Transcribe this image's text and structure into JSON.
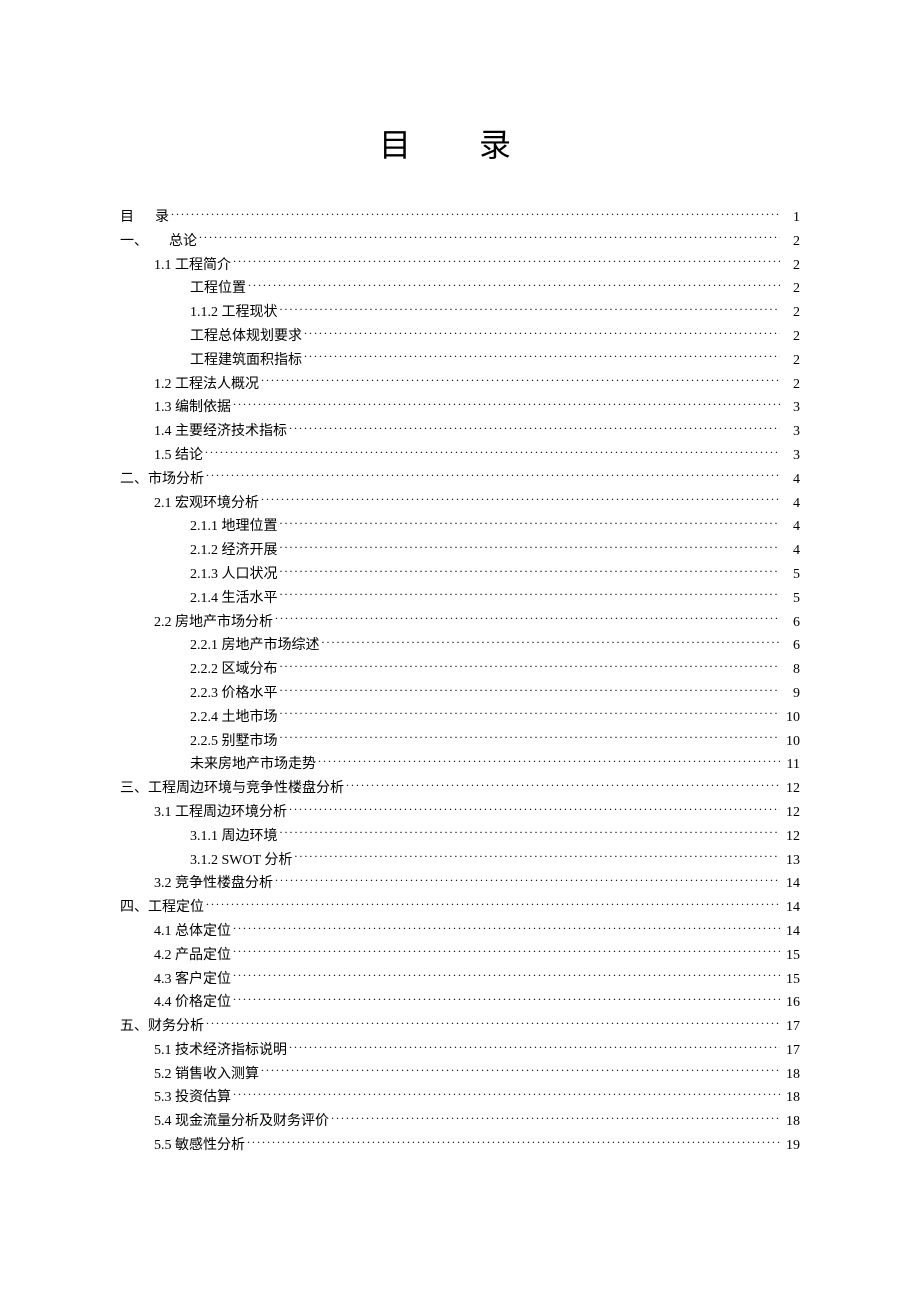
{
  "title": "目 录",
  "toc": [
    {
      "indent": 0,
      "label": "目",
      "spacer": true,
      "label2": "录",
      "page": "1"
    },
    {
      "indent": 0,
      "label": "一、",
      "spacer": true,
      "label2": "总论",
      "page": "2"
    },
    {
      "indent": 1,
      "label": "1.1 工程简介",
      "page": "2"
    },
    {
      "indent": 2,
      "label": "工程位置",
      "page": "2"
    },
    {
      "indent": 2,
      "label": "1.1.2  工程现状",
      "page": "2"
    },
    {
      "indent": 2,
      "label": "工程总体规划要求",
      "page": "2"
    },
    {
      "indent": 2,
      "label": "工程建筑面积指标",
      "page": "2"
    },
    {
      "indent": 1,
      "label": "1.2 工程法人概况",
      "page": "2"
    },
    {
      "indent": 1,
      "label": "1.3 编制依据",
      "page": "3"
    },
    {
      "indent": 1,
      "label": "1.4 主要经济技术指标",
      "page": "3"
    },
    {
      "indent": 1,
      "label": "1.5 结论",
      "page": "3"
    },
    {
      "indent": 0,
      "label": "二、市场分析",
      "page": "4"
    },
    {
      "indent": 1,
      "label": "2.1 宏观环境分析",
      "page": "4"
    },
    {
      "indent": 2,
      "label": "2.1.1  地理位置",
      "page": "4"
    },
    {
      "indent": 2,
      "label": "2.1.2  经济开展",
      "page": "4"
    },
    {
      "indent": 2,
      "label": "2.1.3  人口状况",
      "page": "5"
    },
    {
      "indent": 2,
      "label": "2.1.4  生活水平",
      "page": "5"
    },
    {
      "indent": 1,
      "label": "2.2 房地产市场分析",
      "page": "6"
    },
    {
      "indent": 2,
      "label": "2.2.1  房地产市场综述",
      "page": "6"
    },
    {
      "indent": 2,
      "label": "2.2.2  区域分布",
      "page": "8"
    },
    {
      "indent": 2,
      "label": "2.2.3  价格水平",
      "page": "9"
    },
    {
      "indent": 2,
      "label": "2.2.4  土地市场",
      "page": "10"
    },
    {
      "indent": 2,
      "label": "2.2.5  别墅市场",
      "page": "10"
    },
    {
      "indent": 2,
      "label": "未来房地产市场走势",
      "page": "11"
    },
    {
      "indent": 0,
      "label": "三、工程周边环境与竞争性楼盘分析",
      "page": "12"
    },
    {
      "indent": 1,
      "label": "3.1 工程周边环境分析",
      "page": "12"
    },
    {
      "indent": 2,
      "label": "3.1.1  周边环境",
      "page": "12"
    },
    {
      "indent": 2,
      "label": "3.1.2 SWOT 分析",
      "page": "13"
    },
    {
      "indent": 1,
      "label": "3.2  竞争性楼盘分析",
      "page": "14"
    },
    {
      "indent": 0,
      "label": "四、工程定位",
      "page": "14"
    },
    {
      "indent": 1,
      "label": "4.1  总体定位",
      "page": "14"
    },
    {
      "indent": 1,
      "label": "4.2  产品定位",
      "page": "15"
    },
    {
      "indent": 1,
      "label": "4.3  客户定位",
      "page": "15"
    },
    {
      "indent": 1,
      "label": "4.4  价格定位",
      "page": "16"
    },
    {
      "indent": 0,
      "label": "五、财务分析",
      "page": "17"
    },
    {
      "indent": 1,
      "label": "5.1  技术经济指标说明",
      "page": "17"
    },
    {
      "indent": 1,
      "label": "5.2  销售收入测算",
      "page": "18"
    },
    {
      "indent": 1,
      "label": "5.3 投资估算",
      "page": "18"
    },
    {
      "indent": 1,
      "label": "5.4 现金流量分析及财务评价",
      "page": "18"
    },
    {
      "indent": 1,
      "label": "5.5 敏感性分析",
      "page": "19"
    }
  ],
  "indentPx": [
    0,
    34,
    70
  ]
}
